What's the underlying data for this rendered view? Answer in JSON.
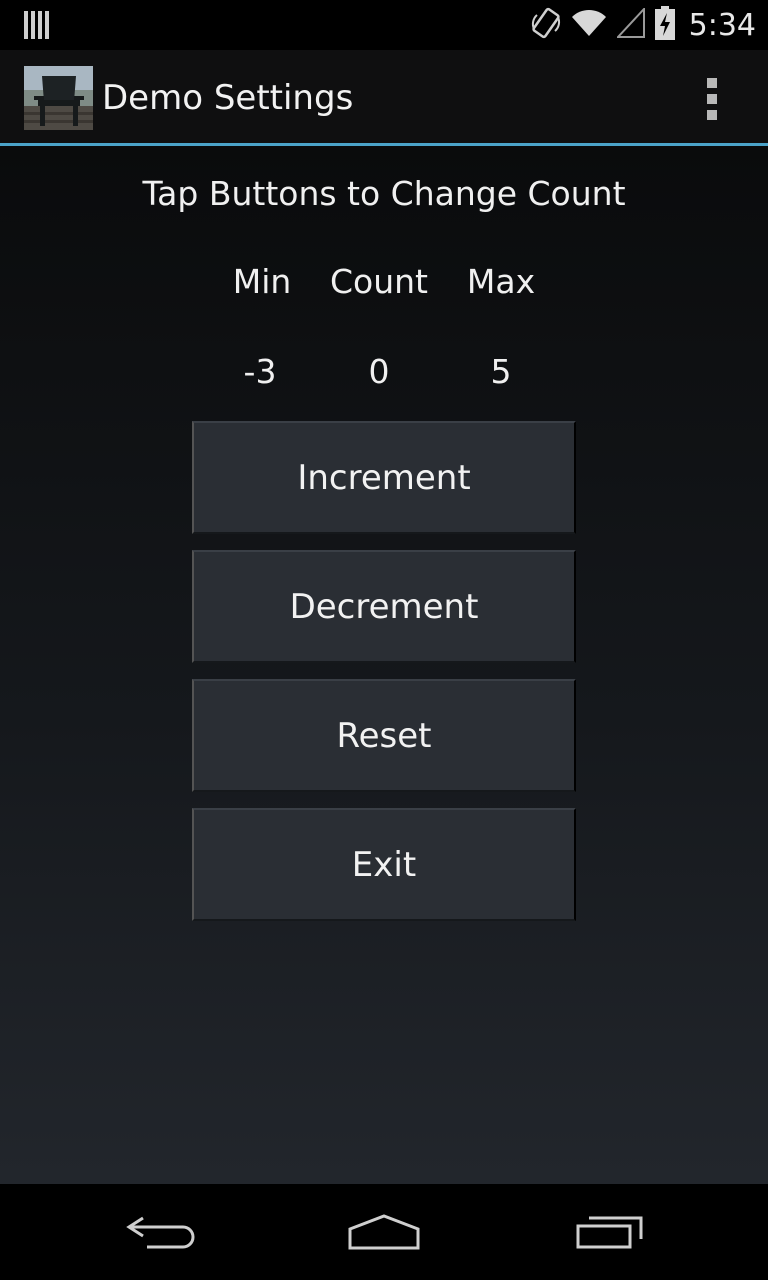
{
  "status_bar": {
    "time": "5:34",
    "icons": [
      "notification-bars-icon",
      "rotation-icon",
      "wifi-icon",
      "signal-icon",
      "battery-charging-icon"
    ]
  },
  "action_bar": {
    "title": "Demo Settings",
    "app_icon": "adirondack-chair-icon",
    "menu_icon": "overflow-menu-icon",
    "divider_color": "#4ba3c9"
  },
  "main": {
    "instructions": "Tap Buttons to Change Count",
    "labels": {
      "min": "Min",
      "count": "Count",
      "max": "Max"
    },
    "values": {
      "min": "-3",
      "count": "0",
      "max": "5"
    },
    "buttons": {
      "increment": "Increment",
      "decrement": "Decrement",
      "reset": "Reset",
      "exit": "Exit"
    }
  },
  "nav_bar": {
    "icons": [
      "back-icon",
      "home-icon",
      "recent-apps-icon"
    ]
  }
}
